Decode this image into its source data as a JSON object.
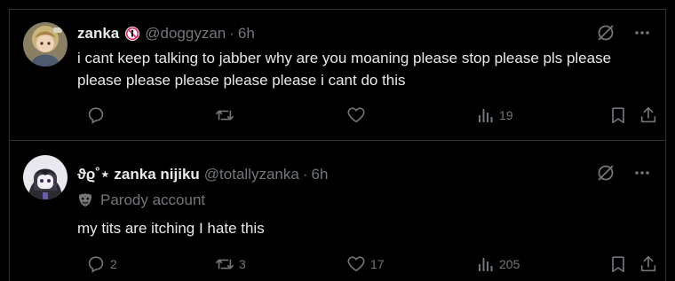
{
  "posts": [
    {
      "display_name": "zanka",
      "handle": "@doggyzan",
      "separator": "·",
      "time": "6h",
      "text": "i cant keep talking to jabber why are you moaning please stop please pls please please please please please please i cant do this",
      "reply_count": "",
      "repost_count": "",
      "like_count": "",
      "view_count": "19"
    },
    {
      "display_name": "ϑϱ˚⋆ zanka nijiku",
      "handle": "@totallyzanka",
      "separator": "·",
      "time": "6h",
      "parody_label": "Parody account",
      "text": "my tits are itching I hate this",
      "reply_count": "2",
      "repost_count": "3",
      "like_count": "17",
      "view_count": "205"
    }
  ],
  "icons": {
    "badge": "no-entry-badge-icon",
    "parody": "mask-icon",
    "grok": "grok-icon",
    "more": "more-icon",
    "reply": "reply-icon",
    "repost": "repost-icon",
    "like": "heart-icon",
    "views": "views-icon",
    "bookmark": "bookmark-icon",
    "share": "share-icon"
  },
  "colors": {
    "background": "#000000",
    "text": "#e7e9ea",
    "secondary": "#71767b",
    "border": "#2f3336"
  }
}
